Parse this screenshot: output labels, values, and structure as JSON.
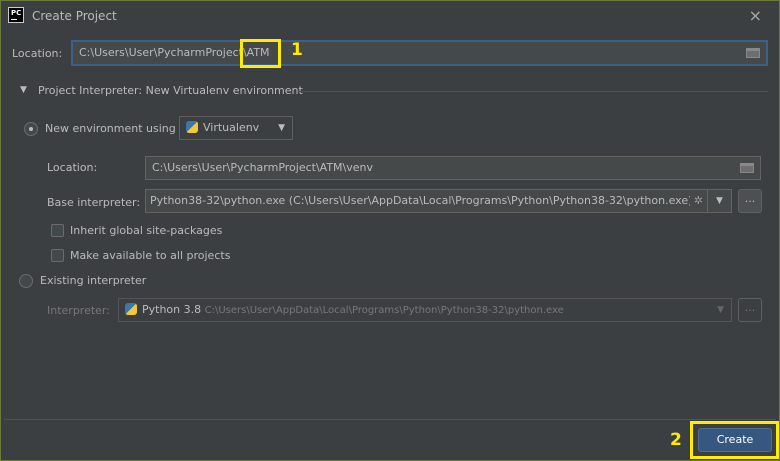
{
  "window": {
    "title": "Create Project",
    "close_icon": "×"
  },
  "location": {
    "label": "Location:",
    "value_prefix": "C:\\Users\\User\\PycharmProject\\",
    "value_highlight": "ATM"
  },
  "annotations": {
    "one": "1",
    "two": "2",
    "highlight_color": "#ffec00"
  },
  "interpreter_section": {
    "title": "Project Interpreter: New Virtualenv environment"
  },
  "new_env": {
    "label": "New environment using",
    "tool": "Virtualenv",
    "location_label": "Location:",
    "location_value": "C:\\Users\\User\\PycharmProject\\ATM\\venv",
    "base_label": "Base interpreter:",
    "base_value": "Python38-32\\python.exe (C:\\Users\\User\\AppData\\Local\\Programs\\Python\\Python38-32\\python.exe)",
    "browse": "...",
    "inherit_label": "Inherit global site-packages",
    "available_label": "Make available to all projects"
  },
  "existing": {
    "label": "Existing interpreter",
    "interp_label": "Interpreter:",
    "interp_name": "Python 3.8",
    "interp_path": "C:\\Users\\User\\AppData\\Local\\Programs\\Python\\Python38-32\\python.exe",
    "browse": "..."
  },
  "footer": {
    "create": "Create"
  }
}
